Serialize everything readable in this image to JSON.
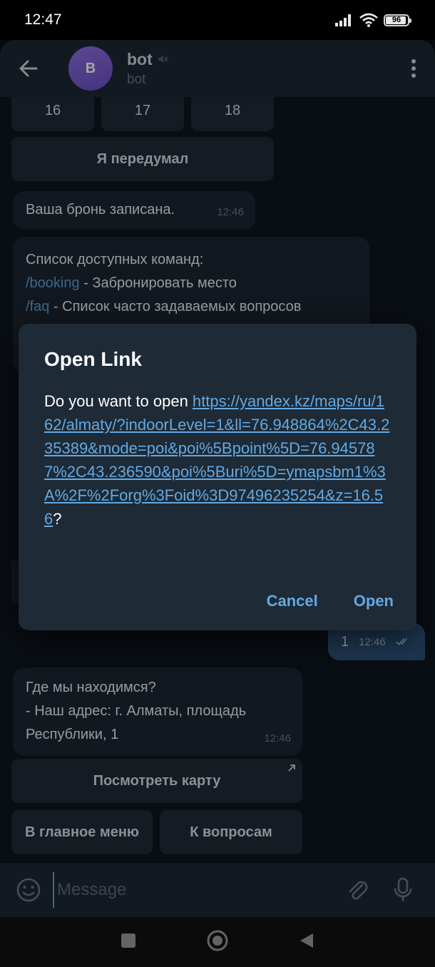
{
  "status": {
    "time": "12:47",
    "battery": "96"
  },
  "header": {
    "avatar_letter": "B",
    "title": "bot",
    "subtitle": "bot"
  },
  "keyboard_top": {
    "row1": [
      "16",
      "17",
      "18"
    ],
    "cancel": "Я передумал"
  },
  "messages": {
    "booking_saved": {
      "text": "Ваша бронь записана.",
      "time": "12:46"
    },
    "commands": {
      "title": "Список доступных команд:",
      "items": [
        {
          "cmd": "/booking",
          "desc": " - Забронировать место"
        },
        {
          "cmd": "/faq",
          "desc": " - Список часто задаваемых вопросов"
        }
      ]
    },
    "outgoing": {
      "text": "1",
      "time": "12:46"
    },
    "location": {
      "lines": [
        "Где мы находимся?",
        "- Наш адрес: г. Алматы, площадь",
        "Республики, 1"
      ],
      "time": "12:46"
    }
  },
  "keyboard_bottom": {
    "map": "Посмотреть карту",
    "main_menu": "В главное меню",
    "questions": "К вопросам"
  },
  "composer": {
    "placeholder": "Message"
  },
  "dialog": {
    "title": "Open Link",
    "prompt": "Do you want to open ",
    "url": "https://yandex.kz/maps/ru/162/almaty/?indoorLevel=1&ll=76.948864%2C43.235389&mode=poi&poi%5Bpoint%5D=76.945787%2C43.236590&poi%5Buri%5D=ymapsbm1%3A%2F%2Forg%3Foid%3D97496235254&z=16.56",
    "suffix": "?",
    "cancel": "Cancel",
    "open": "Open"
  },
  "colors": {
    "accent": "#62a9e4",
    "bubble_in": "#1c2630",
    "bubble_out": "#2b5278",
    "header": "#1d2733"
  }
}
